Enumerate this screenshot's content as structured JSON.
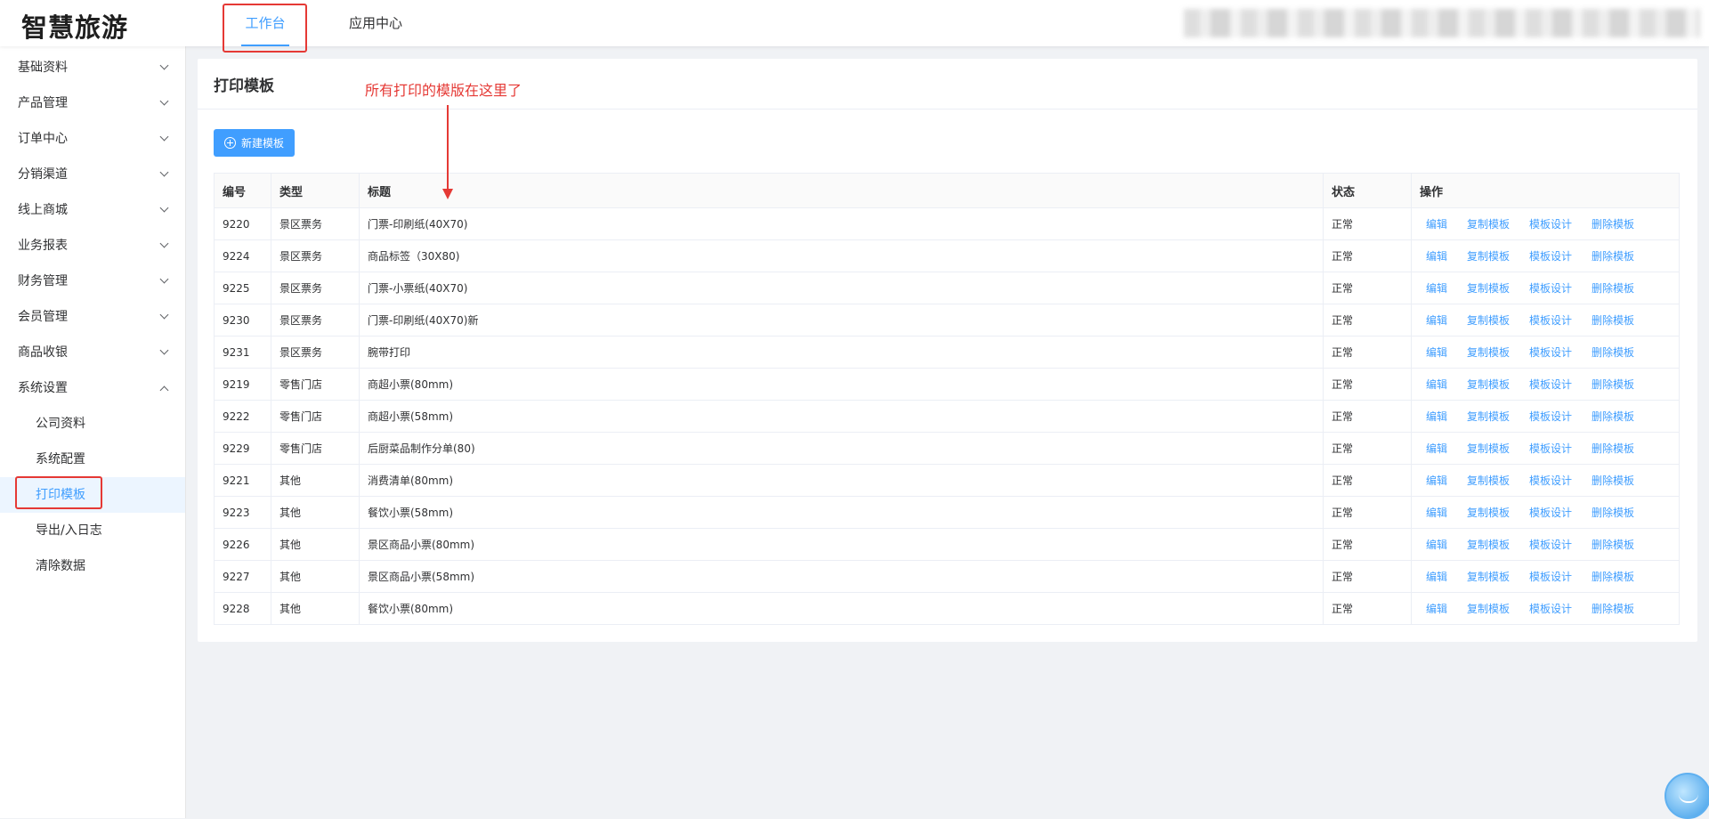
{
  "app": {
    "logo": "智慧旅游"
  },
  "top_tabs": [
    {
      "label": "工作台",
      "active": true
    },
    {
      "label": "应用中心",
      "active": false
    }
  ],
  "sidebar": {
    "items": [
      {
        "label": "基础资料"
      },
      {
        "label": "产品管理"
      },
      {
        "label": "订单中心"
      },
      {
        "label": "分销渠道"
      },
      {
        "label": "线上商城"
      },
      {
        "label": "业务报表"
      },
      {
        "label": "财务管理"
      },
      {
        "label": "会员管理"
      },
      {
        "label": "商品收银"
      },
      {
        "label": "系统设置",
        "expanded": true
      }
    ],
    "sub_items": [
      {
        "label": "公司资料"
      },
      {
        "label": "系统配置"
      },
      {
        "label": "打印模板",
        "active": true
      },
      {
        "label": "导出/入日志"
      },
      {
        "label": "清除数据"
      }
    ]
  },
  "main": {
    "title": "打印模板",
    "annotation": "所有打印的模版在这里了",
    "new_button": "新建模板",
    "table": {
      "headers": [
        "编号",
        "类型",
        "标题",
        "状态",
        "操作"
      ],
      "actions": [
        "编辑",
        "复制模板",
        "模板设计",
        "删除模板"
      ],
      "rows": [
        {
          "id": "9220",
          "type": "景区票务",
          "title": "门票-印刷纸(40X70)",
          "status": "正常"
        },
        {
          "id": "9224",
          "type": "景区票务",
          "title": "商品标签（30X80)",
          "status": "正常"
        },
        {
          "id": "9225",
          "type": "景区票务",
          "title": "门票-小票纸(40X70)",
          "status": "正常"
        },
        {
          "id": "9230",
          "type": "景区票务",
          "title": "门票-印刷纸(40X70)新",
          "status": "正常"
        },
        {
          "id": "9231",
          "type": "景区票务",
          "title": "腕带打印",
          "status": "正常"
        },
        {
          "id": "9219",
          "type": "零售门店",
          "title": "商超小票(80mm)",
          "status": "正常"
        },
        {
          "id": "9222",
          "type": "零售门店",
          "title": "商超小票(58mm)",
          "status": "正常"
        },
        {
          "id": "9229",
          "type": "零售门店",
          "title": "后厨菜品制作分单(80)",
          "status": "正常"
        },
        {
          "id": "9221",
          "type": "其他",
          "title": "消费清单(80mm)",
          "status": "正常"
        },
        {
          "id": "9223",
          "type": "其他",
          "title": "餐饮小票(58mm)",
          "status": "正常"
        },
        {
          "id": "9226",
          "type": "其他",
          "title": "景区商品小票(80mm)",
          "status": "正常"
        },
        {
          "id": "9227",
          "type": "其他",
          "title": "景区商品小票(58mm)",
          "status": "正常"
        },
        {
          "id": "9228",
          "type": "其他",
          "title": "餐饮小票(80mm)",
          "status": "正常"
        }
      ]
    }
  },
  "colors": {
    "accent": "#409eff",
    "annotation_red": "#e53935"
  },
  "icons": {
    "chevron": "chevron-down-icon",
    "new": "plus-circle-icon",
    "assistant": "assistant-bot-icon"
  }
}
